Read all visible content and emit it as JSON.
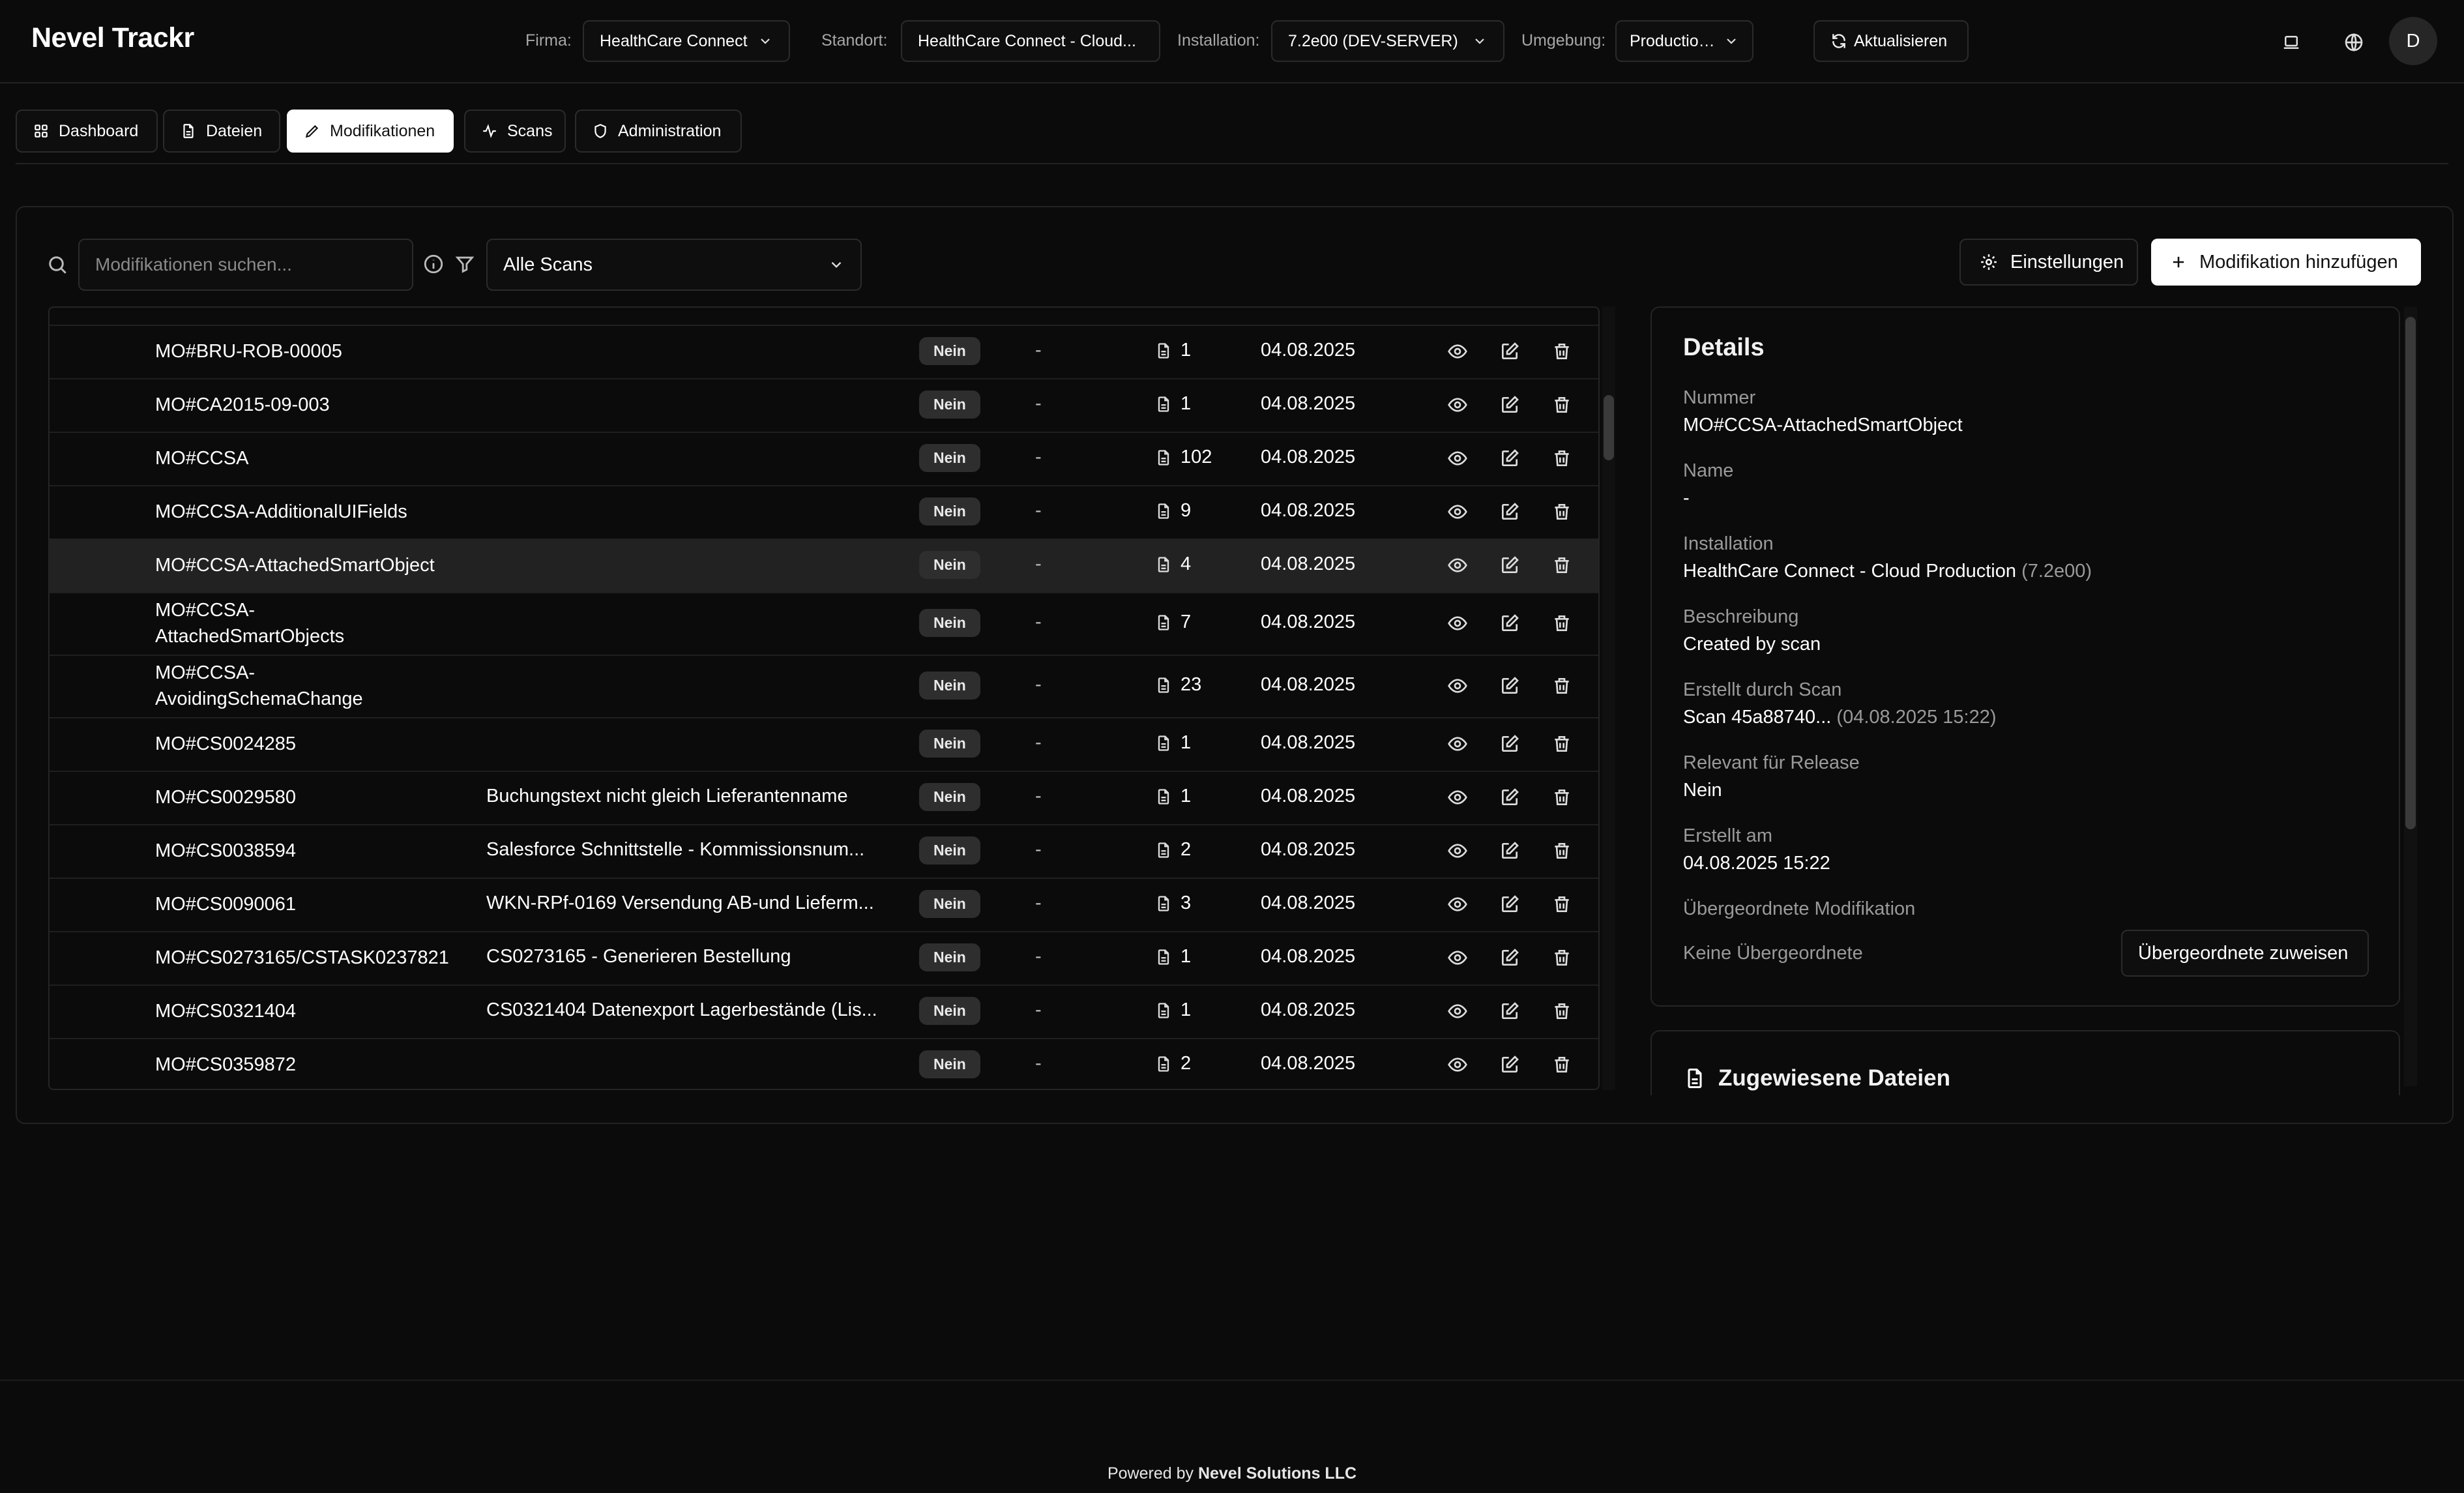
{
  "header": {
    "brand": "Nevel Trackr",
    "firma_label": "Firma:",
    "firma_value": "HealthCare Connect",
    "standort_label": "Standort:",
    "standort_value": "HealthCare Connect - Cloud...",
    "installation_label": "Installation:",
    "installation_value": "7.2e00 (DEV-SERVER)",
    "umgebung_label": "Umgebung:",
    "umgebung_value": "Production (LIVE)",
    "refresh_label": "Aktualisieren",
    "avatar_initial": "D"
  },
  "tabs": [
    {
      "label": "Dashboard",
      "icon": "grid-icon",
      "active": false
    },
    {
      "label": "Dateien",
      "icon": "file-icon",
      "active": false
    },
    {
      "label": "Modifikationen",
      "icon": "pencil-icon",
      "active": true
    },
    {
      "label": "Scans",
      "icon": "activity-icon",
      "active": false
    },
    {
      "label": "Administration",
      "icon": "shield-icon",
      "active": false
    }
  ],
  "toolbar": {
    "search_placeholder": "Modifikationen suchen...",
    "scan_filter": "Alle Scans",
    "settings_label": "Einstellungen",
    "add_label": "Modifikation hinzufügen"
  },
  "table": {
    "rows": [
      {
        "nummer": "MO#BRU-ROB-00005",
        "name": "",
        "release": "Nein",
        "parent": "-",
        "files": "1",
        "date": "04.08.2025"
      },
      {
        "nummer": "MO#CA2015-09-003",
        "name": "",
        "release": "Nein",
        "parent": "-",
        "files": "1",
        "date": "04.08.2025"
      },
      {
        "nummer": "MO#CCSA",
        "name": "",
        "release": "Nein",
        "parent": "-",
        "files": "102",
        "date": "04.08.2025"
      },
      {
        "nummer": "MO#CCSA-AdditionalUIFields",
        "name": "",
        "release": "Nein",
        "parent": "-",
        "files": "9",
        "date": "04.08.2025"
      },
      {
        "nummer": "MO#CCSA-AttachedSmartObject",
        "name": "",
        "release": "Nein",
        "parent": "-",
        "files": "4",
        "date": "04.08.2025",
        "selected": true
      },
      {
        "nummer": "MO#CCSA-\nAttachedSmartObjects",
        "name": "",
        "release": "Nein",
        "parent": "-",
        "files": "7",
        "date": "04.08.2025"
      },
      {
        "nummer": "MO#CCSA-\nAvoidingSchemaChange",
        "name": "",
        "release": "Nein",
        "parent": "-",
        "files": "23",
        "date": "04.08.2025"
      },
      {
        "nummer": "MO#CS0024285",
        "name": "",
        "release": "Nein",
        "parent": "-",
        "files": "1",
        "date": "04.08.2025"
      },
      {
        "nummer": "MO#CS0029580",
        "name": "Buchungstext nicht gleich Lieferantenname",
        "release": "Nein",
        "parent": "-",
        "files": "1",
        "date": "04.08.2025"
      },
      {
        "nummer": "MO#CS0038594",
        "name": "Salesforce Schnittstelle - Kommissionsnum...",
        "release": "Nein",
        "parent": "-",
        "files": "2",
        "date": "04.08.2025"
      },
      {
        "nummer": "MO#CS0090061",
        "name": "WKN-RPf-0169 Versendung AB-und Lieferm...",
        "release": "Nein",
        "parent": "-",
        "files": "3",
        "date": "04.08.2025"
      },
      {
        "nummer": "MO#CS0273165/CSTASK0237821",
        "name": "CS0273165 - Generieren Bestellung",
        "release": "Nein",
        "parent": "-",
        "files": "1",
        "date": "04.08.2025"
      },
      {
        "nummer": "MO#CS0321404",
        "name": "CS0321404 Datenexport Lagerbestände (Lis...",
        "release": "Nein",
        "parent": "-",
        "files": "1",
        "date": "04.08.2025"
      },
      {
        "nummer": "MO#CS0359872",
        "name": "",
        "release": "Nein",
        "parent": "-",
        "files": "2",
        "date": "04.08.2025"
      }
    ]
  },
  "details": {
    "title": "Details",
    "nummer_label": "Nummer",
    "nummer_value": "MO#CCSA-AttachedSmartObject",
    "name_label": "Name",
    "name_value": "-",
    "installation_label": "Installation",
    "installation_value": "HealthCare Connect - Cloud Production",
    "installation_version": "(7.2e00)",
    "beschreibung_label": "Beschreibung",
    "beschreibung_value": "Created by scan",
    "scan_label": "Erstellt durch Scan",
    "scan_value": "Scan 45a88740...",
    "scan_time": "(04.08.2025 15:22)",
    "release_label": "Relevant für Release",
    "release_value": "Nein",
    "created_label": "Erstellt am",
    "created_value": "04.08.2025 15:22",
    "parent_label": "Übergeordnete Modifikation",
    "parent_value": "Keine Übergeordnete",
    "assign_parent_label": "Übergeordnete zuweisen",
    "assigned_files_title": "Zugewiesene Dateien"
  },
  "footer": {
    "prefix": "Powered by",
    "company": "Nevel Solutions LLC"
  }
}
